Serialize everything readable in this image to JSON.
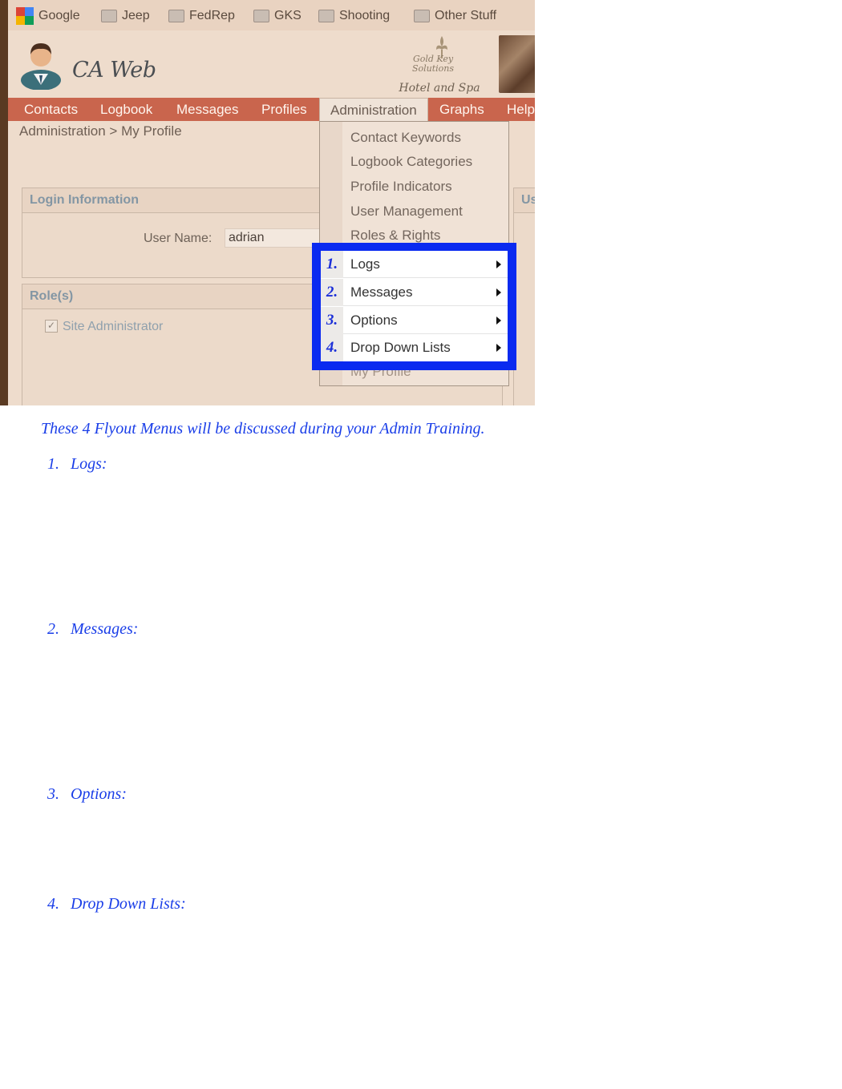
{
  "bookmarks": [
    {
      "label": "Google",
      "icon": "google-icon"
    },
    {
      "label": "Jeep",
      "icon": "folder-icon"
    },
    {
      "label": "FedRep",
      "icon": "folder-icon"
    },
    {
      "label": "GKS",
      "icon": "folder-icon"
    },
    {
      "label": "Shooting",
      "icon": "folder-icon"
    },
    {
      "label": "Other Stuff",
      "icon": "folder-icon"
    }
  ],
  "app": {
    "title": "CA Web",
    "logo_line1": "Gold Key Solutions",
    "logo_line2": "Hotel and Spa"
  },
  "nav": {
    "items": [
      "Contacts",
      "Logbook",
      "Messages",
      "Profiles",
      "Administration",
      "Graphs",
      "Help"
    ],
    "active": "Administration"
  },
  "breadcrumb": "Administration > My Profile",
  "login_panel": {
    "title": "Login Information",
    "username_label": "User Name:",
    "username_value": "adrian"
  },
  "roles_panel": {
    "title": "Role(s)",
    "role": "Site Administrator",
    "checked": true
  },
  "right_panel_partial_title": "Us",
  "admin_menu": {
    "items": [
      "Contact Keywords",
      "Logbook Categories",
      "Profile Indicators",
      "User Management",
      "Roles & Rights"
    ],
    "flyouts": [
      {
        "num": "1.",
        "label": "Logs"
      },
      {
        "num": "2.",
        "label": "Messages"
      },
      {
        "num": "3.",
        "label": "Options"
      },
      {
        "num": "4.",
        "label": "Drop Down Lists"
      }
    ],
    "last_item": "My Profile"
  },
  "colors": {
    "highlight": "#0a2af0",
    "nav_bar": "#c9654d",
    "doc_text": "#1a3ee8"
  },
  "document": {
    "intro": "These 4 Flyout Menus will be discussed during your Admin Training.",
    "sections": [
      {
        "num": "1.",
        "label": "Logs:"
      },
      {
        "num": "2.",
        "label": "Messages:"
      },
      {
        "num": "3.",
        "label": "Options:"
      },
      {
        "num": "4.",
        "label": "Drop Down Lists:"
      }
    ]
  }
}
